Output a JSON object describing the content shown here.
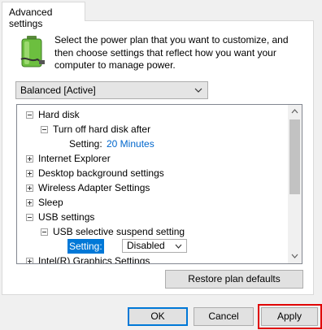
{
  "tab": {
    "label": "Advanced settings"
  },
  "description": "Select the power plan that you want to customize, and then choose settings that reflect how you want your computer to manage power.",
  "plan_select": {
    "value": "Balanced [Active]"
  },
  "tree": {
    "hard_disk": "Hard disk",
    "turn_off_hard_disk": "Turn off hard disk after",
    "setting_label": "Setting:",
    "hard_disk_setting_value": "20 Minutes",
    "internet_explorer": "Internet Explorer",
    "desktop_background": "Desktop background settings",
    "wireless_adapter": "Wireless Adapter Settings",
    "sleep": "Sleep",
    "usb_settings": "USB settings",
    "usb_selective_suspend": "USB selective suspend setting",
    "usb_setting_value": "Disabled",
    "intel_graphics": "Intel(R) Graphics Settings"
  },
  "buttons": {
    "restore": "Restore plan defaults",
    "ok": "OK",
    "cancel": "Cancel",
    "apply": "Apply"
  },
  "colors": {
    "link": "#0066cc",
    "selection": "#0078d7",
    "highlight": "#e00000"
  }
}
